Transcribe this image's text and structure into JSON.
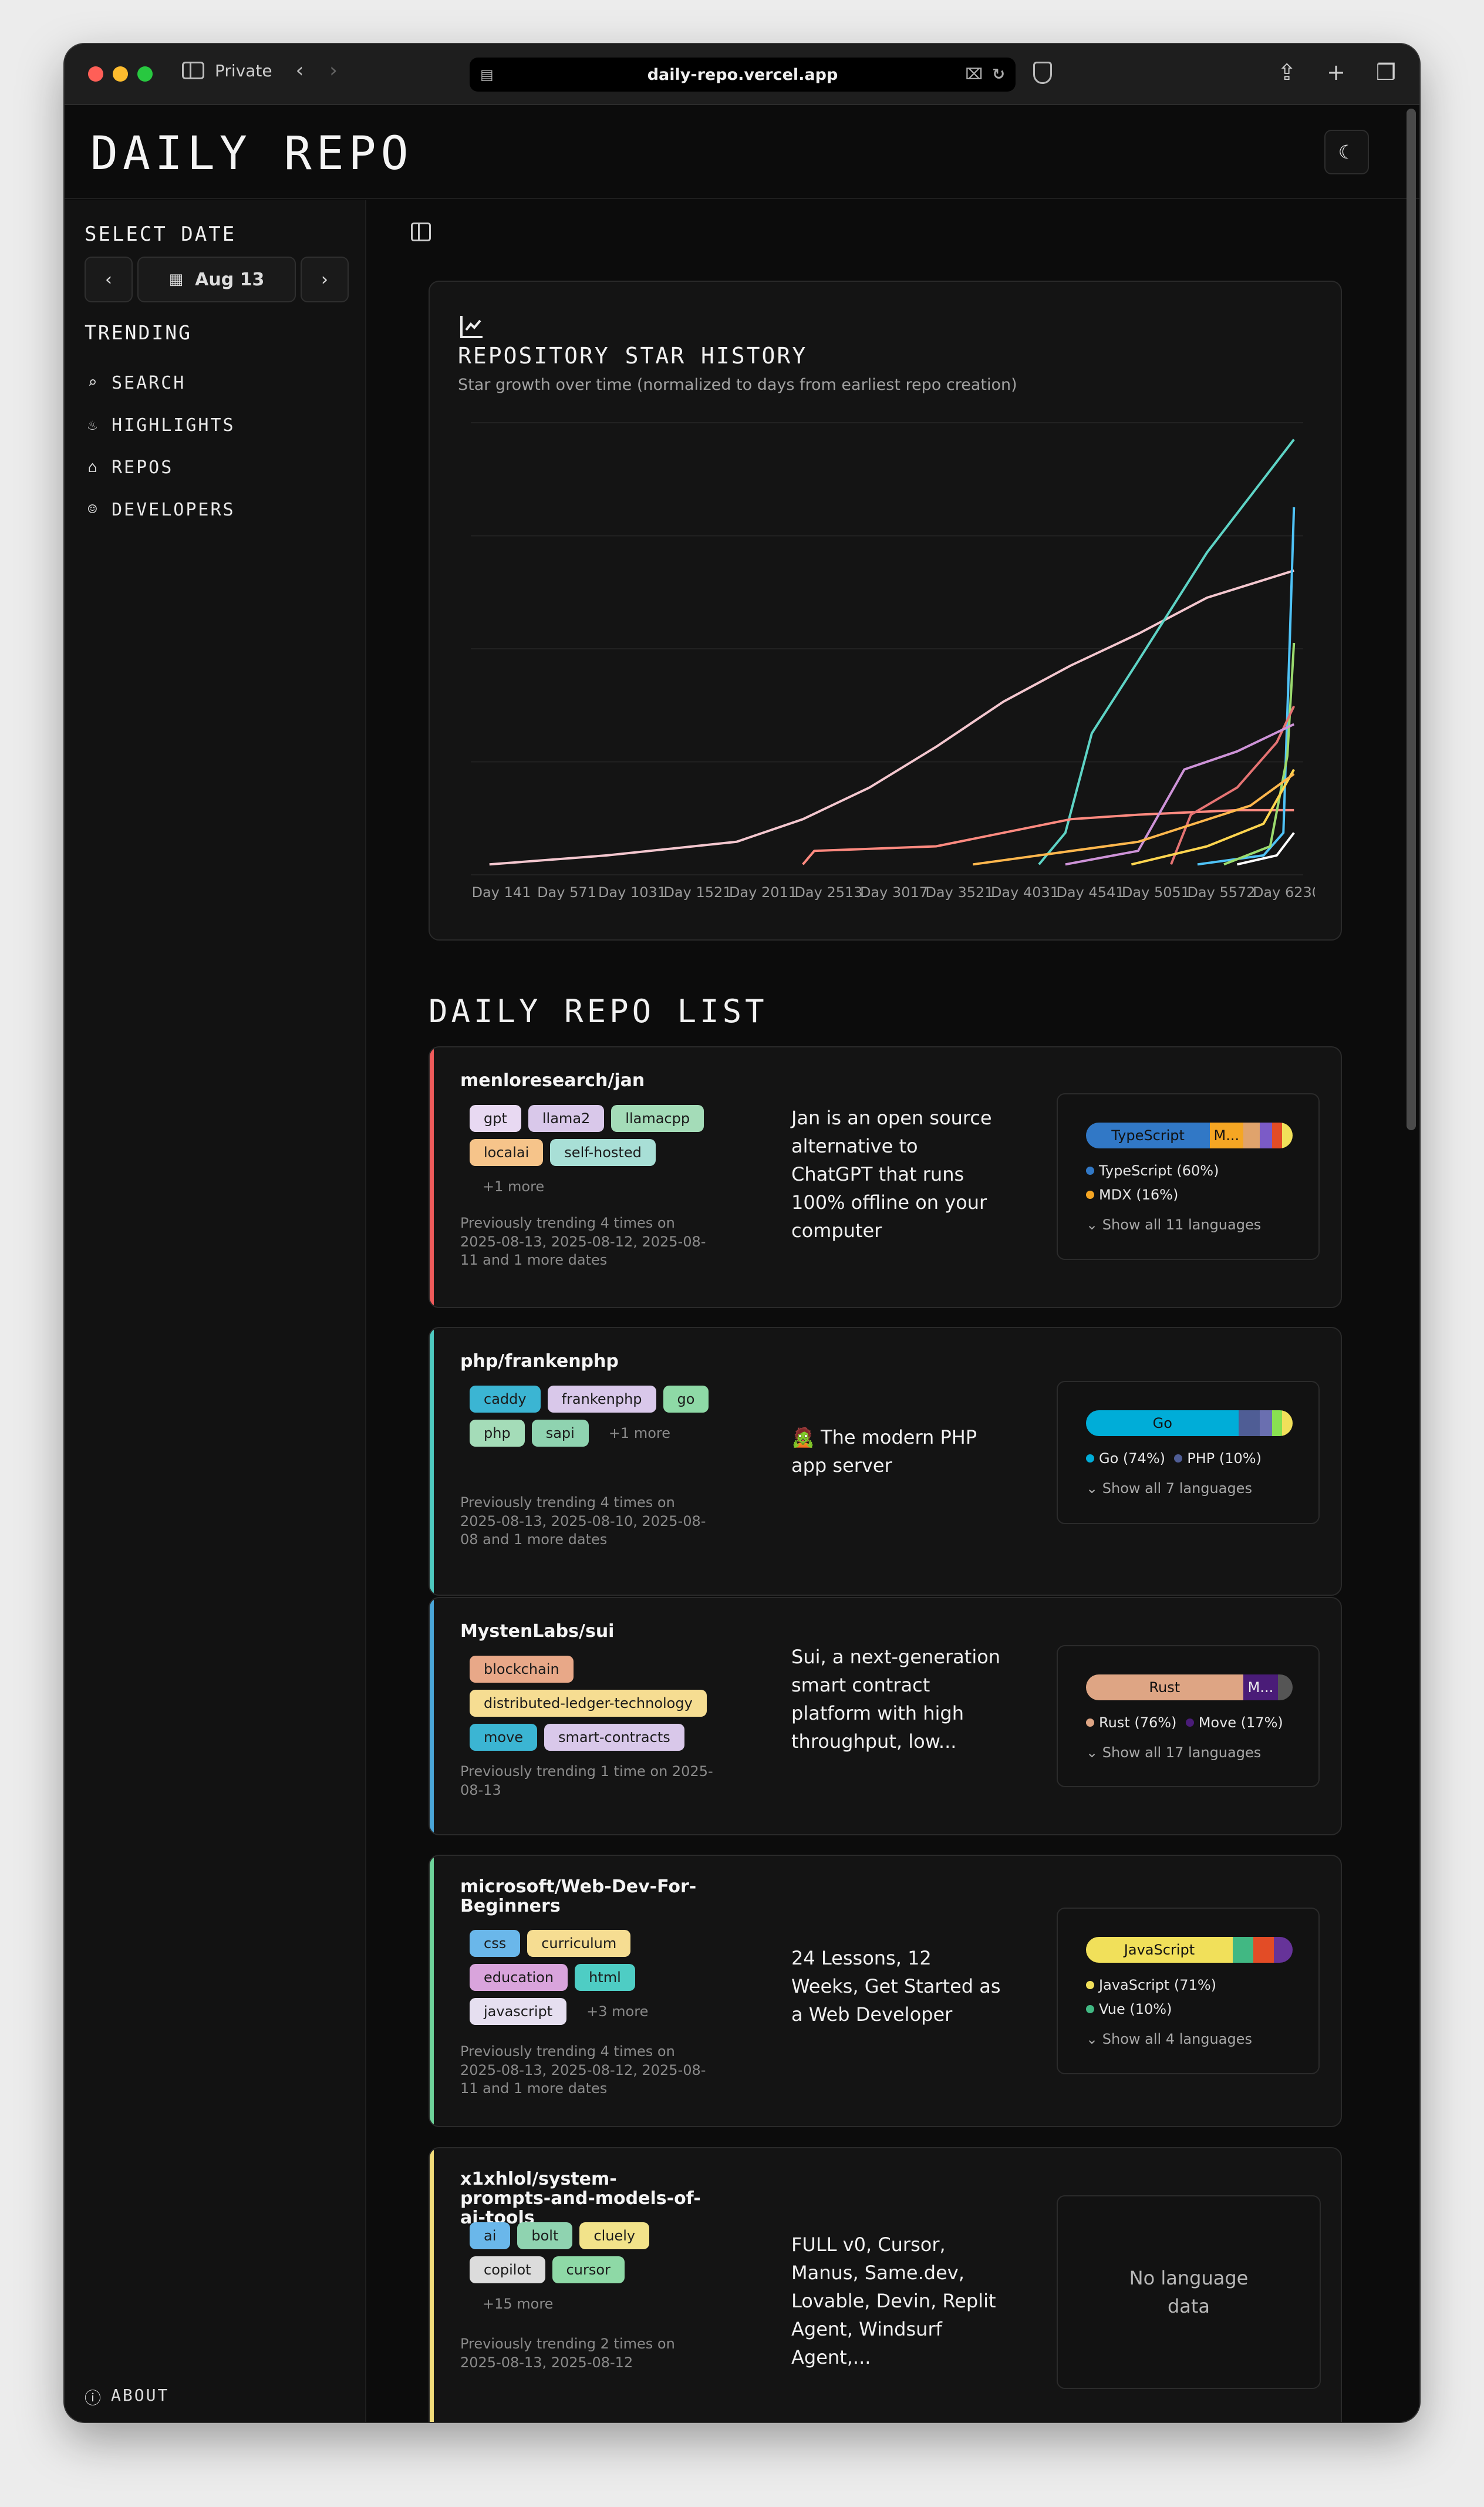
{
  "browser": {
    "private_label": "Private",
    "url": "daily-repo.vercel.app"
  },
  "app": {
    "logo": "DAILY REPO"
  },
  "sidebar": {
    "select_date": "SELECT DATE",
    "date": "Aug 13",
    "trending": "TRENDING",
    "items": [
      {
        "label": "SEARCH",
        "icon": "search-icon"
      },
      {
        "label": "HIGHLIGHTS",
        "icon": "flame-icon"
      },
      {
        "label": "REPOS",
        "icon": "home-icon"
      },
      {
        "label": "DEVELOPERS",
        "icon": "person-icon"
      }
    ],
    "about": "ABOUT"
  },
  "chart_card": {
    "title": "REPOSITORY STAR HISTORY",
    "subtitle": "Star growth over time (normalized to days from earliest repo creation)"
  },
  "chart_data": {
    "type": "line",
    "x_ticks": [
      "Day 141",
      "Day 571",
      "Day 1031",
      "Day 1521",
      "Day 2011",
      "Day 2513",
      "Day 3017",
      "Day 3521",
      "Day 4031",
      "Day 4541",
      "Day 5051",
      "Day 5572",
      "Day 6230"
    ],
    "xlim": [
      0,
      6300
    ],
    "ylim": [
      0,
      100
    ],
    "grid": true,
    "legend": "none",
    "series": [
      {
        "color": "#f4c7cf",
        "points": [
          [
            141,
            1
          ],
          [
            1031,
            3
          ],
          [
            2011,
            6
          ],
          [
            2513,
            11
          ],
          [
            3017,
            18
          ],
          [
            3521,
            27
          ],
          [
            4031,
            37
          ],
          [
            4541,
            45
          ],
          [
            5051,
            52
          ],
          [
            5572,
            60
          ],
          [
            6230,
            66
          ]
        ]
      },
      {
        "color": "#5ed4c6",
        "points": [
          [
            4300,
            1
          ],
          [
            4500,
            8
          ],
          [
            4700,
            30
          ],
          [
            5051,
            46
          ],
          [
            5572,
            70
          ],
          [
            6230,
            95
          ]
        ]
      },
      {
        "color": "#ff8a80",
        "points": [
          [
            2513,
            1
          ],
          [
            2600,
            4
          ],
          [
            3521,
            5
          ],
          [
            4541,
            11
          ],
          [
            5051,
            12
          ],
          [
            5800,
            13
          ],
          [
            6230,
            13
          ]
        ]
      },
      {
        "color": "#4fc3f7",
        "points": [
          [
            5500,
            1
          ],
          [
            6000,
            3
          ],
          [
            6150,
            8
          ],
          [
            6200,
            52
          ],
          [
            6230,
            80
          ]
        ]
      },
      {
        "color": "#9bdb6e",
        "points": [
          [
            5700,
            1
          ],
          [
            6050,
            5
          ],
          [
            6180,
            25
          ],
          [
            6230,
            50
          ]
        ]
      },
      {
        "color": "#e57373",
        "points": [
          [
            5300,
            1
          ],
          [
            5450,
            12
          ],
          [
            5800,
            18
          ],
          [
            6100,
            28
          ],
          [
            6230,
            36
          ]
        ]
      },
      {
        "color": "#ce93d8",
        "points": [
          [
            4500,
            1
          ],
          [
            5051,
            4
          ],
          [
            5400,
            22
          ],
          [
            5800,
            26
          ],
          [
            6230,
            32
          ]
        ]
      },
      {
        "color": "#ffd54f",
        "points": [
          [
            5000,
            1
          ],
          [
            5572,
            5
          ],
          [
            6000,
            10
          ],
          [
            6230,
            22
          ]
        ]
      },
      {
        "color": "#ffb74d",
        "points": [
          [
            3800,
            1
          ],
          [
            5051,
            6
          ],
          [
            5900,
            14
          ],
          [
            6230,
            21
          ]
        ]
      },
      {
        "color": "#ffffff",
        "points": [
          [
            5800,
            1
          ],
          [
            6100,
            3
          ],
          [
            6230,
            8
          ]
        ]
      }
    ]
  },
  "list": {
    "title": "DAILY REPO LIST",
    "repos": [
      {
        "name": "menloresearch/jan",
        "tags": [
          "gpt",
          "llama2",
          "llamacpp",
          "localai",
          "self-hosted"
        ],
        "more": "+1 more",
        "prev": "Previously trending 4 times on 2025-08-13, 2025-08-12, 2025-08-11 and 1 more dates",
        "desc": "Jan is an open source alternative to ChatGPT that runs 100% offline on your computer",
        "bar_label": "TypeScript",
        "bar_label2": "M...",
        "legend1": "TypeScript (60%)",
        "legend2": "MDX (16%)",
        "show_all": "Show all 11 languages"
      },
      {
        "name": "php/frankenphp",
        "tags": [
          "caddy",
          "frankenphp",
          "go",
          "php",
          "sapi"
        ],
        "more": "+1 more",
        "prev": "Previously trending 4 times on 2025-08-13, 2025-08-10, 2025-08-08 and 1 more dates",
        "desc": "🧟 The modern PHP app server",
        "bar_label": "Go",
        "legend1": "Go (74%)",
        "legend2": "PHP (10%)",
        "show_all": "Show all 7 languages"
      },
      {
        "name": "MystenLabs/sui",
        "tags": [
          "blockchain",
          "distributed-ledger-technology",
          "move",
          "smart-contracts"
        ],
        "prev": "Previously trending 1 time on 2025-08-13",
        "desc": "Sui, a next-generation smart contract platform with high throughput, low...",
        "bar_label": "Rust",
        "bar_label2": "M...",
        "legend1": "Rust (76%)",
        "legend2": "Move (17%)",
        "show_all": "Show all 17 languages"
      },
      {
        "name": "microsoft/Web-Dev-For-Beginners",
        "tags": [
          "css",
          "curriculum",
          "education",
          "html",
          "javascript"
        ],
        "more": "+3 more",
        "prev": "Previously trending 4 times on 2025-08-13, 2025-08-12, 2025-08-11 and 1 more dates",
        "desc": "24 Lessons, 12 Weeks, Get Started as a Web Developer",
        "bar_label": "JavaScript",
        "legend1": "JavaScript (71%)",
        "legend2": "Vue (10%)",
        "show_all": "Show all 4 languages"
      },
      {
        "name": "x1xhlol/system-prompts-and-models-of-ai-tools",
        "tags": [
          "ai",
          "bolt",
          "cluely",
          "copilot",
          "cursor"
        ],
        "more": "+15 more",
        "prev": "Previously trending 2 times on 2025-08-13, 2025-08-12",
        "desc": "FULL v0, Cursor, Manus, Same.dev, Lovable, Devin, Replit Agent, Windsurf Agent,...",
        "no_lang": "No language data"
      }
    ]
  },
  "colors": {
    "stripe_red": "#ef5b5b",
    "stripe_teal": "#4ec9c0",
    "stripe_blue": "#4aa6d8",
    "stripe_green": "#6ed39a",
    "stripe_yellow": "#f2dc7a",
    "typescript": "#3178c6",
    "go": "#00add8",
    "rust": "#dea584",
    "javascript": "#f1e05a"
  }
}
